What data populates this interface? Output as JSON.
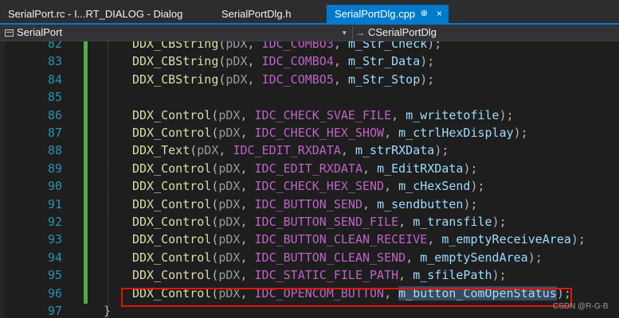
{
  "tabs": [
    {
      "label": "SerialPort.rc - I...RT_DIALOG - Dialog",
      "active": false
    },
    {
      "label": "SerialPortDlg.h",
      "active": false
    },
    {
      "label": "SerialPortDlg.cpp",
      "active": true,
      "pin_glyph": "⊕",
      "close_glyph": "×"
    }
  ],
  "navbar": {
    "project": "SerialPort",
    "scope_hint": "→",
    "scope": "CSerialPortDlg",
    "dropdown_glyph": "▾"
  },
  "code_lines": [
    {
      "n": "82",
      "fn": "DDX_CBString",
      "param": "pDX",
      "id": "IDC_COMBO3",
      "var": "m_Str_Check",
      "end": ");"
    },
    {
      "n": "83",
      "fn": "DDX_CBString",
      "param": "pDX",
      "id": "IDC_COMBO4",
      "var": "m_Str_Data",
      "end": ");"
    },
    {
      "n": "84",
      "fn": "DDX_CBString",
      "param": "pDX",
      "id": "IDC_COMBO5",
      "var": "m_Str_Stop",
      "end": ");"
    },
    {
      "n": "85"
    },
    {
      "n": "86",
      "fn": "DDX_Control",
      "param": "pDX",
      "id": "IDC_CHECK_SVAE_FILE",
      "var": "m_writetofile",
      "end": ");"
    },
    {
      "n": "87",
      "fn": "DDX_Control",
      "param": "pDX",
      "id": "IDC_CHECK_HEX_SHOW",
      "var": "m_ctrlHexDisplay",
      "end": ");"
    },
    {
      "n": "88",
      "fn": "DDX_Text",
      "param": "pDX",
      "id": "IDC_EDIT_RXDATA",
      "var": "m_strRXData",
      "end": ");"
    },
    {
      "n": "89",
      "fn": "DDX_Control",
      "param": "pDX",
      "id": "IDC_EDIT_RXDATA",
      "var": "m_EditRXData",
      "end": ");"
    },
    {
      "n": "90",
      "fn": "DDX_Control",
      "param": "pDX",
      "id": "IDC_CHECK_HEX_SEND",
      "var": "m_cHexSend",
      "end": ");"
    },
    {
      "n": "91",
      "fn": "DDX_Control",
      "param": "pDX",
      "id": "IDC_BUTTON_SEND",
      "var": "m_sendbutten",
      "end": ");"
    },
    {
      "n": "92",
      "fn": "DDX_Control",
      "param": "pDX",
      "id": "IDC_BUTTON_SEND_FILE",
      "var": "m_transfile",
      "end": ");"
    },
    {
      "n": "93",
      "fn": "DDX_Control",
      "param": "pDX",
      "id": "IDC_BUTTON_CLEAN_RECEIVE",
      "var": "m_emptyReceiveArea",
      "end": ");"
    },
    {
      "n": "94",
      "fn": "DDX_Control",
      "param": "pDX",
      "id": "IDC_BUTTON_CLEAN_SEND",
      "var": "m_emptySendArea",
      "end": ");"
    },
    {
      "n": "95",
      "fn": "DDX_Control",
      "param": "pDX",
      "id": "IDC_STATIC_FILE_PATH",
      "var": "m_sfilePath",
      "end": ");"
    },
    {
      "n": "96",
      "fn": "DDX_Control",
      "param": "pDX",
      "id": "IDC_OPENCOM_BUTTON",
      "var": "m_button_ComOpenStatus",
      "end": ");",
      "highlight": true
    },
    {
      "n": "97",
      "text": "}"
    }
  ],
  "watermark": "CSDN @R-G-B",
  "colors": {
    "background": "#1e1e1e",
    "tab_active": "#007acc",
    "line_number": "#2b91af",
    "function": "#dcdcaa",
    "macro": "#bd63c5",
    "variable": "#9cdcfe",
    "highlight_box": "#e51400",
    "change_bar": "#57a64a"
  }
}
